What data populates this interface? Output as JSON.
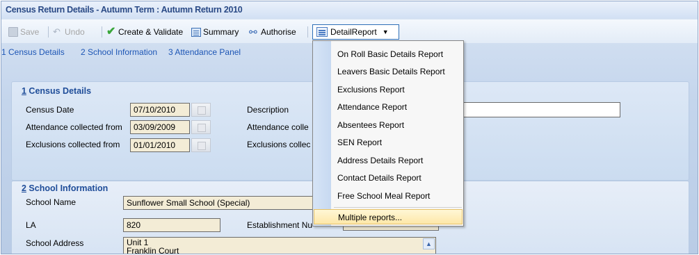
{
  "window": {
    "title": "Census Return Details - Autumn Term : Autumn Return 2010"
  },
  "toolbar": {
    "save_label": "Save",
    "undo_label": "Undo",
    "create_validate_label": "Create & Validate",
    "summary_label": "Summary",
    "authorise_label": "Authorise",
    "detail_report_label": "DetailReport"
  },
  "nav": {
    "links": [
      {
        "label": "1 Census Details"
      },
      {
        "label": "2 School Information"
      },
      {
        "label": "3 Attendance Panel"
      }
    ]
  },
  "census_details": {
    "title_num": "1",
    "title_text": " Census Details",
    "census_date_label": "Census Date",
    "census_date_value": "07/10/2010",
    "description_label": "Description",
    "attendance_from_label": "Attendance collected from",
    "attendance_from_value": "03/09/2009",
    "attendance_to_label": "Attendance colle",
    "exclusions_from_label": "Exclusions collected from",
    "exclusions_from_value": "01/01/2010",
    "exclusions_to_label": "Exclusions collec"
  },
  "school_information": {
    "title_num": "2",
    "title_text": " School Information",
    "school_name_label": "School Name",
    "school_name_value": "Sunflower Small School (Special)",
    "la_label": "LA",
    "la_value": "820",
    "establishment_label": "Establishment Nu",
    "school_address_label": "School Address",
    "address_line1": "Unit 1",
    "address_line2": "Franklin Court"
  },
  "detail_report_menu": {
    "items": [
      {
        "label": "On Roll Basic Details Report"
      },
      {
        "label": "Leavers Basic Details Report"
      },
      {
        "label": "Exclusions Report"
      },
      {
        "label": "Attendance Report"
      },
      {
        "label": "Absentees Report"
      },
      {
        "label": "SEN Report"
      },
      {
        "label": "Address Details Report"
      },
      {
        "label": "Contact Details Report"
      },
      {
        "label": "Free School Meal Report"
      }
    ],
    "highlighted_item": "Multiple reports..."
  }
}
